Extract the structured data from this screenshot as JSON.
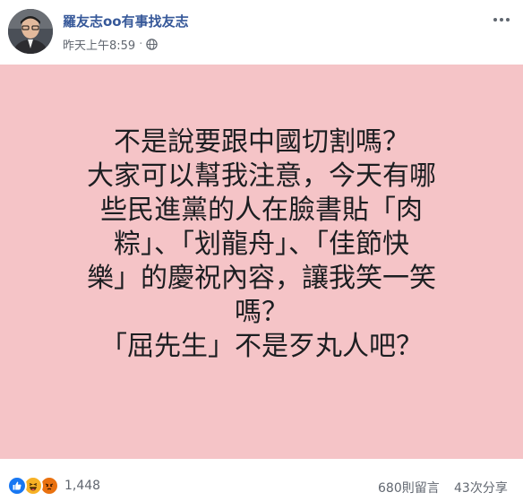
{
  "post": {
    "author": "羅友志oo有事找友志",
    "timestamp": "昨天上午8:59",
    "separator": "·",
    "privacy_icon": "globe-icon",
    "more_icon": "more-options-icon"
  },
  "card": {
    "background": "#f5c4c7",
    "lines": [
      "不是說要跟中國切割嗎？",
      "大家可以幫我注意，今天有哪",
      "些民進黨的人在臉書貼「肉",
      "粽」、「划龍舟」、「佳節快",
      "樂」的慶祝內容，讓我笑一笑",
      "嗎？",
      "「屈先生」不是歹丸人吧？"
    ]
  },
  "footer": {
    "reaction_icons": [
      "like-icon",
      "haha-icon",
      "angry-icon"
    ],
    "reaction_count": "1,448",
    "comments": "680則留言",
    "shares": "43次分享"
  }
}
